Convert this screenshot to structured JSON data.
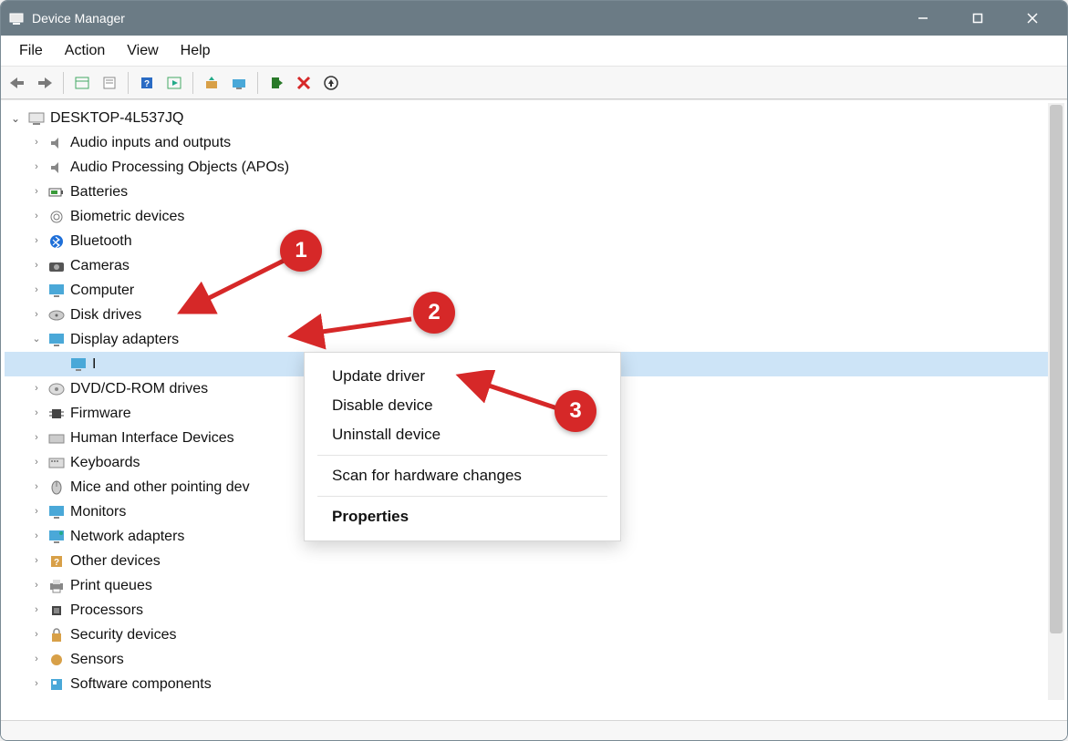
{
  "window": {
    "title": "Device Manager"
  },
  "menubar": {
    "file": "File",
    "action": "Action",
    "view": "View",
    "help": "Help"
  },
  "tree": {
    "root": "DESKTOP-4L537JQ",
    "items": [
      {
        "label": "Audio inputs and outputs",
        "icon": "speaker"
      },
      {
        "label": "Audio Processing Objects (APOs)",
        "icon": "speaker"
      },
      {
        "label": "Batteries",
        "icon": "battery"
      },
      {
        "label": "Biometric devices",
        "icon": "fingerprint"
      },
      {
        "label": "Bluetooth",
        "icon": "bluetooth"
      },
      {
        "label": "Cameras",
        "icon": "camera"
      },
      {
        "label": "Computer",
        "icon": "monitor"
      },
      {
        "label": "Disk drives",
        "icon": "disk"
      },
      {
        "label": "Display adapters",
        "icon": "display",
        "expanded": true,
        "child_label": "I"
      },
      {
        "label": "DVD/CD-ROM drives",
        "icon": "cdrom"
      },
      {
        "label": "Firmware",
        "icon": "chip"
      },
      {
        "label": "Human Interface Devices",
        "icon": "hid"
      },
      {
        "label": "Keyboards",
        "icon": "keyboard"
      },
      {
        "label": "Mice and other pointing dev",
        "icon": "mouse"
      },
      {
        "label": "Monitors",
        "icon": "monitor"
      },
      {
        "label": "Network adapters",
        "icon": "network"
      },
      {
        "label": "Other devices",
        "icon": "other"
      },
      {
        "label": "Print queues",
        "icon": "printer"
      },
      {
        "label": "Processors",
        "icon": "cpu"
      },
      {
        "label": "Security devices",
        "icon": "security"
      },
      {
        "label": "Sensors",
        "icon": "sensor"
      },
      {
        "label": "Software components",
        "icon": "software"
      }
    ]
  },
  "context_menu": {
    "update": "Update driver",
    "disable": "Disable device",
    "uninstall": "Uninstall device",
    "scan": "Scan for hardware changes",
    "properties": "Properties"
  },
  "annotations": {
    "one": "1",
    "two": "2",
    "three": "3"
  }
}
